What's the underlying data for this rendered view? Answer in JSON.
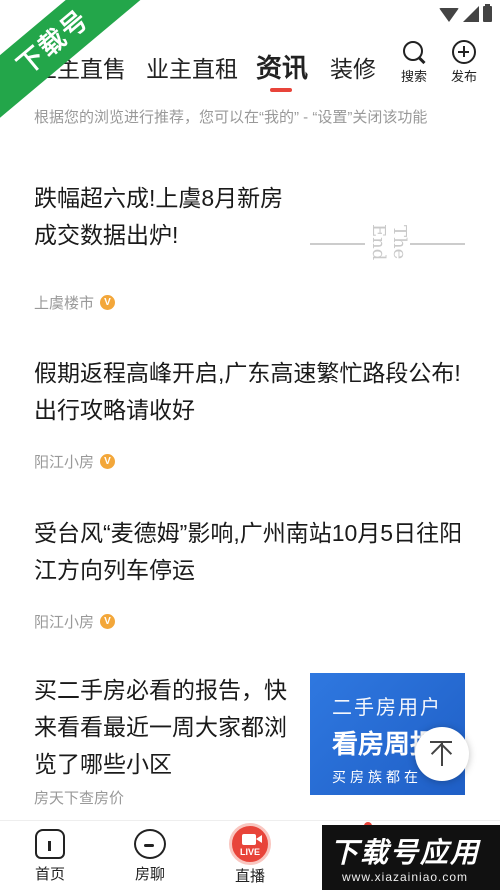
{
  "watermark_corner": "下载号",
  "tabs": [
    {
      "label": "业主直售"
    },
    {
      "label": "业主直租"
    },
    {
      "label": "资讯"
    },
    {
      "label": "装修"
    }
  ],
  "actions": {
    "search_label": "搜索",
    "publish_label": "发布"
  },
  "notice": "根据您的浏览进行推荐，您可以在“我的” - “设置”关闭该功能",
  "articles": [
    {
      "title": "跌幅超六成!上虞8月新房成交数据出炉!",
      "source": "上虞楼市",
      "thumb_text": "The End"
    },
    {
      "title": "假期返程高峰开启,广东高速繁忙路段公布!出行攻略请收好",
      "source": "阳江小房"
    },
    {
      "title": "受台风“麦德姆”影响,广州南站10月5日往阳江方向列车停运",
      "source": "阳江小房"
    },
    {
      "title": "买二手房必看的报告，快来看看最近一周大家都浏览了哪些小区",
      "source": "房天下查房价",
      "thumb": {
        "line1": "二手房用户",
        "line2": "看房周报",
        "line3": "买房族都在"
      }
    }
  ],
  "bottom_nav": {
    "home": "首页",
    "chat": "房聊",
    "live": "直播",
    "live_badge": "LIVE"
  },
  "watermark_footer": {
    "big": "下载号应用",
    "small": "www.xiazainiao.com"
  },
  "colors": {
    "accent": "#e8443a",
    "watermark_green": "#23a64a",
    "report_blue": "#2f78e0"
  }
}
